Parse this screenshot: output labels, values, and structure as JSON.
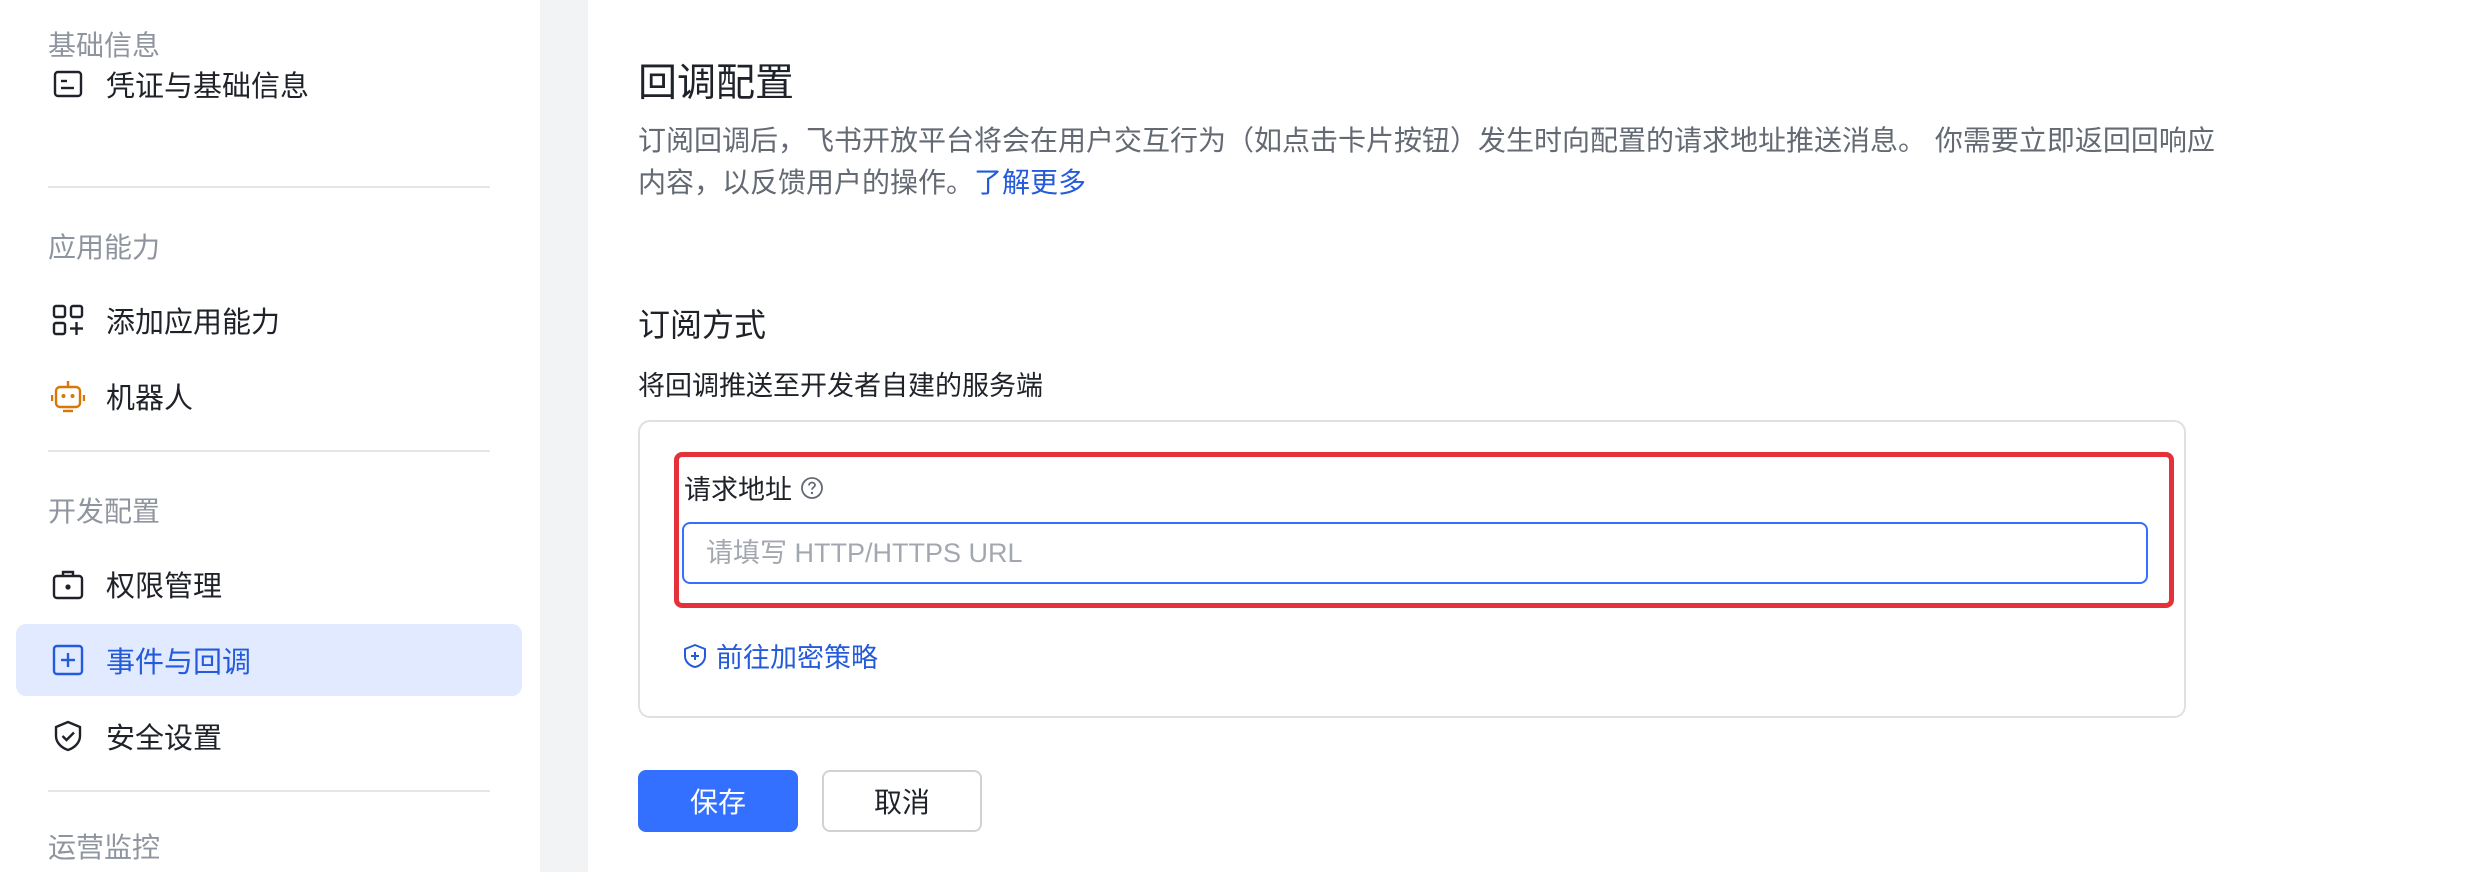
{
  "sidebar": {
    "sections": [
      {
        "title": "基础信息",
        "items": [
          {
            "label": "凭证与基础信息",
            "icon": "credential-icon"
          }
        ]
      },
      {
        "title": "应用能力",
        "items": [
          {
            "label": "添加应用能力",
            "icon": "add-grid-icon"
          },
          {
            "label": "机器人",
            "icon": "robot-icon"
          }
        ]
      },
      {
        "title": "开发配置",
        "items": [
          {
            "label": "权限管理",
            "icon": "permission-briefcase-icon"
          },
          {
            "label": "事件与回调",
            "icon": "event-callback-icon",
            "active": true
          },
          {
            "label": "安全设置",
            "icon": "shield-icon"
          }
        ]
      },
      {
        "title": "运营监控",
        "items": []
      }
    ]
  },
  "main": {
    "title": "回调配置",
    "description": "订阅回调后，飞书开放平台将会在用户交互行为（如点击卡片按钮）发生时向配置的请求地址推送消息。 你需要立即返回回响应内容，以反馈用户的操作。",
    "learn_more": "了解更多",
    "subscription_title": "订阅方式",
    "subscription_desc": "将回调推送至开发者自建的服务端",
    "request_url_label": "请求地址",
    "request_url_value": "",
    "request_url_placeholder": "请填写 HTTP/HTTPS URL",
    "encrypt_link": "前往加密策略",
    "save_label": "保存",
    "cancel_label": "取消"
  },
  "colors": {
    "accent": "#3370ff",
    "active_bg": "#e1eaff",
    "highlight_border": "#e5323a",
    "robot_icon": "#d97706"
  }
}
